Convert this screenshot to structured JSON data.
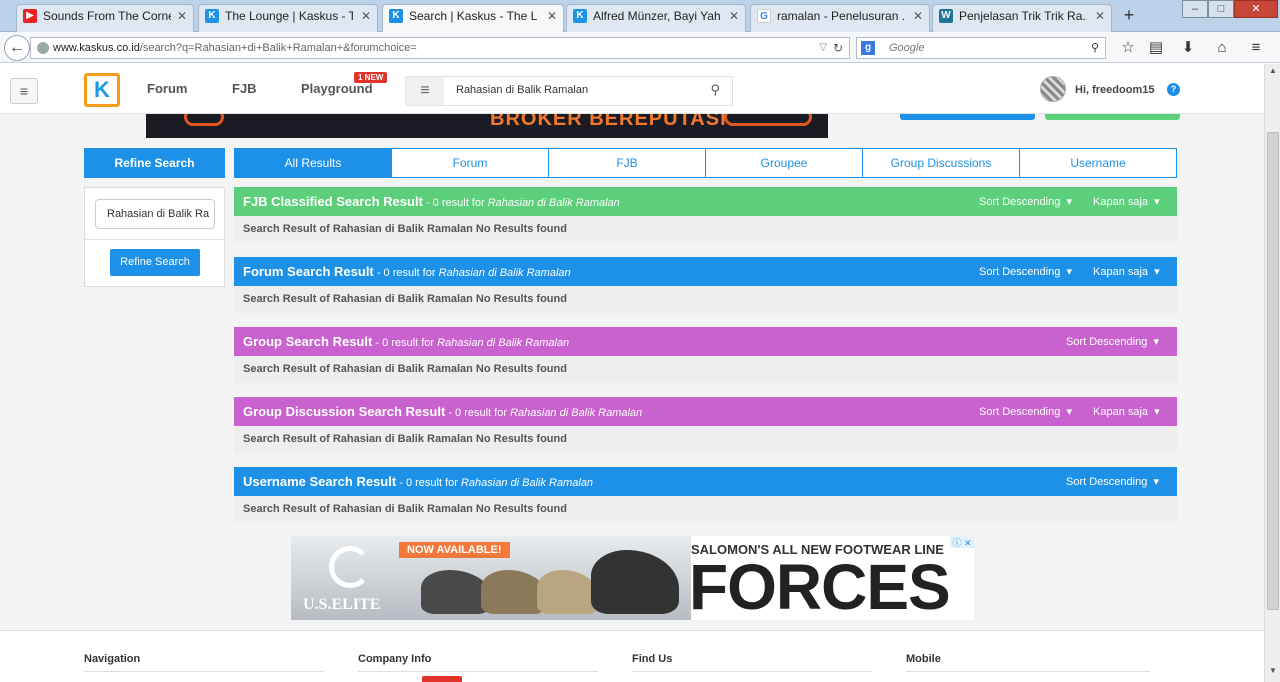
{
  "browser": {
    "tabs": [
      {
        "label": "Sounds From The Corne...",
        "icon": "youtube-icon",
        "color": "#e22"
      },
      {
        "label": "The Lounge | Kaskus - T...",
        "icon": "kaskus-icon",
        "color": "#1d91e7"
      },
      {
        "label": "Search | Kaskus - The La...",
        "icon": "kaskus-icon",
        "color": "#1d91e7"
      },
      {
        "label": "Alfred Münzer, Bayi Yah...",
        "icon": "kaskus-icon",
        "color": "#1d91e7"
      },
      {
        "label": "ramalan - Penelusuran ...",
        "icon": "google-icon",
        "color": "#4285f4"
      },
      {
        "label": "Penjelasan Trik Trik Ra...",
        "icon": "wordpress-icon",
        "color": "#21759b"
      }
    ],
    "url_domain": "www.kaskus.co.id",
    "url_path": "/search?q=Rahasian+di+Balik+Ramalan+&forumchoice=",
    "search_placeholder": "Google"
  },
  "header": {
    "nav": [
      "Forum",
      "FJB",
      "Playground"
    ],
    "new_badge": "1 NEW",
    "search_value": "Rahasian di Balik Ramalan",
    "greeting": "Hi, freedoom15",
    "help": "?"
  },
  "banner": {
    "text": "BROKER BEREPUTASI"
  },
  "sidebar": {
    "heading": "Refine Search",
    "input_value": "Rahasian di Balik Ra",
    "button": "Refine Search"
  },
  "result_tabs": [
    "All Results",
    "Forum",
    "FJB",
    "Groupee",
    "Group Discussions",
    "Username"
  ],
  "sections": [
    {
      "title": "FJB Classified Search Result",
      "count": " - 0 result for ",
      "query": "Rahasian di Balik Ramalan",
      "sort": "Sort Descending",
      "time": "Kapan saja",
      "body": "Search Result of Rahasian di Balik Ramalan No Results found",
      "color": "#5ccf7a"
    },
    {
      "title": "Forum Search Result",
      "count": " - 0 result for ",
      "query": "Rahasian di Balik Ramalan",
      "sort": "Sort Descending",
      "time": "Kapan saja",
      "body": "Search Result of Rahasian di Balik Ramalan No Results found",
      "color": "#1d91e7"
    },
    {
      "title": "Group Search Result",
      "count": " - 0 result for ",
      "query": "Rahasian di Balik Ramalan",
      "sort": "Sort Descending",
      "time": "",
      "body": "Search Result of Rahasian di Balik Ramalan No Results found",
      "color": "#c962cf"
    },
    {
      "title": "Group Discussion Search Result",
      "count": " - 0 result for ",
      "query": "Rahasian di Balik Ramalan",
      "sort": "Sort Descending",
      "time": "Kapan saja",
      "body": "Search Result of Rahasian di Balik Ramalan No Results found",
      "color": "#c962cf"
    },
    {
      "title": "Username Search Result",
      "count": " - 0 result for ",
      "query": "Rahasian di Balik Ramalan",
      "sort": "Sort Descending",
      "time": "",
      "body": "Search Result of Rahasian di Balik Ramalan No Results found",
      "color": "#1d91e7"
    }
  ],
  "ad": {
    "available": "NOW AVAILABLE!",
    "brand": "U.S.ELITE",
    "headline": "SALOMON'S ALL NEW FOOTWEAR LINE",
    "big": "FORCES"
  },
  "footer": {
    "columns": [
      "Navigation",
      "Company Info",
      "Find Us",
      "Mobile"
    ]
  }
}
